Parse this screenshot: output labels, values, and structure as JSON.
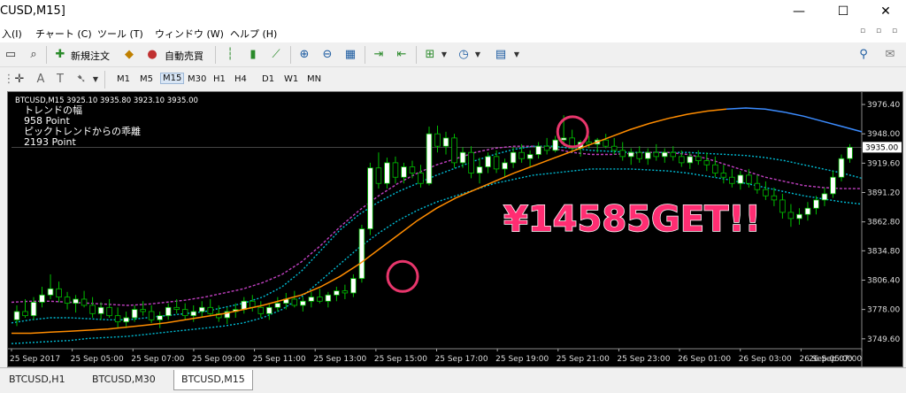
{
  "window": {
    "title": "CUSD,M15]",
    "minimize": "—",
    "maximize": "☐",
    "close": "✕"
  },
  "menu": [
    "入(I)",
    "チャート (C)",
    "ツール (T)",
    "ウィンドウ (W)",
    "ヘルプ (H)"
  ],
  "toolbar": {
    "new_order": "新規注文",
    "auto_trade": "自動売買"
  },
  "timeframes": [
    "M1",
    "M5",
    "M15",
    "M30",
    "H1",
    "H4",
    "D1",
    "W1",
    "MN"
  ],
  "active_timeframe": "M15",
  "chart_data": {
    "type": "candlestick",
    "symbol_header": "BTCUSD,M15  3925.10 3935.80 3923.10 3935.00",
    "indicator_lines": [
      "トレンドの幅",
      "958 Point",
      "ピックトレンドからの乖離",
      "2193 Point"
    ],
    "annotation": "¥14585GET!!",
    "current_price": "3935.00",
    "y_ticks": [
      "3976.40",
      "3948.00",
      "3919.60",
      "3891.20",
      "3862.80",
      "3834.80",
      "3806.40",
      "3778.00",
      "3749.60"
    ],
    "x_ticks": [
      "25 Sep 2017",
      "25 Sep 05:00",
      "25 Sep 07:00",
      "25 Sep 09:00",
      "25 Sep 11:00",
      "25 Sep 13:00",
      "25 Sep 15:00",
      "25 Sep 17:00",
      "25 Sep 19:00",
      "25 Sep 21:00",
      "25 Sep 23:00",
      "26 Sep 01:00",
      "26 Sep 03:00",
      "26 Sep 05:00",
      "26 Sep 07:00"
    ],
    "ylim": [
      3740,
      3985
    ],
    "candles": [
      [
        3768,
        3782,
        3762,
        3776
      ],
      [
        3776,
        3788,
        3770,
        3772
      ],
      [
        3772,
        3790,
        3768,
        3785
      ],
      [
        3785,
        3800,
        3780,
        3792
      ],
      [
        3792,
        3812,
        3788,
        3798
      ],
      [
        3798,
        3805,
        3785,
        3790
      ],
      [
        3790,
        3795,
        3778,
        3784
      ],
      [
        3784,
        3792,
        3775,
        3788
      ],
      [
        3788,
        3796,
        3780,
        3782
      ],
      [
        3782,
        3790,
        3770,
        3774
      ],
      [
        3774,
        3785,
        3768,
        3780
      ],
      [
        3780,
        3788,
        3770,
        3772
      ],
      [
        3772,
        3780,
        3760,
        3766
      ],
      [
        3766,
        3776,
        3760,
        3770
      ],
      [
        3770,
        3782,
        3766,
        3778
      ],
      [
        3778,
        3786,
        3772,
        3776
      ],
      [
        3776,
        3782,
        3765,
        3768
      ],
      [
        3768,
        3776,
        3760,
        3772
      ],
      [
        3772,
        3784,
        3768,
        3780
      ],
      [
        3780,
        3788,
        3774,
        3778
      ],
      [
        3778,
        3784,
        3768,
        3772
      ],
      [
        3772,
        3782,
        3766,
        3776
      ],
      [
        3776,
        3786,
        3770,
        3780
      ],
      [
        3780,
        3788,
        3772,
        3774
      ],
      [
        3774,
        3782,
        3766,
        3770
      ],
      [
        3770,
        3780,
        3764,
        3776
      ],
      [
        3776,
        3784,
        3770,
        3778
      ],
      [
        3778,
        3790,
        3774,
        3786
      ],
      [
        3786,
        3792,
        3776,
        3780
      ],
      [
        3780,
        3786,
        3770,
        3774
      ],
      [
        3774,
        3784,
        3768,
        3780
      ],
      [
        3780,
        3790,
        3776,
        3784
      ],
      [
        3784,
        3794,
        3778,
        3788
      ],
      [
        3788,
        3796,
        3780,
        3782
      ],
      [
        3782,
        3790,
        3776,
        3786
      ],
      [
        3786,
        3795,
        3780,
        3790
      ],
      [
        3790,
        3798,
        3784,
        3786
      ],
      [
        3786,
        3795,
        3780,
        3792
      ],
      [
        3792,
        3800,
        3786,
        3796
      ],
      [
        3796,
        3802,
        3788,
        3794
      ],
      [
        3794,
        3812,
        3790,
        3808
      ],
      [
        3808,
        3860,
        3804,
        3856
      ],
      [
        3856,
        3920,
        3850,
        3915
      ],
      [
        3915,
        3930,
        3895,
        3900
      ],
      [
        3900,
        3925,
        3895,
        3920
      ],
      [
        3920,
        3926,
        3900,
        3906
      ],
      [
        3906,
        3920,
        3900,
        3916
      ],
      [
        3916,
        3922,
        3905,
        3910
      ],
      [
        3910,
        3918,
        3896,
        3900
      ],
      [
        3900,
        3955,
        3898,
        3948
      ],
      [
        3948,
        3956,
        3930,
        3936
      ],
      [
        3936,
        3950,
        3928,
        3944
      ],
      [
        3944,
        3948,
        3915,
        3920
      ],
      [
        3920,
        3935,
        3915,
        3930
      ],
      [
        3930,
        3936,
        3905,
        3910
      ],
      [
        3910,
        3925,
        3900,
        3916
      ],
      [
        3916,
        3930,
        3910,
        3926
      ],
      [
        3926,
        3932,
        3910,
        3914
      ],
      [
        3914,
        3924,
        3906,
        3920
      ],
      [
        3920,
        3935,
        3915,
        3930
      ],
      [
        3930,
        3938,
        3920,
        3924
      ],
      [
        3924,
        3932,
        3916,
        3928
      ],
      [
        3928,
        3940,
        3924,
        3936
      ],
      [
        3936,
        3944,
        3928,
        3932
      ],
      [
        3932,
        3946,
        3930,
        3942
      ],
      [
        3942,
        3966,
        3936,
        3944
      ],
      [
        3944,
        3952,
        3930,
        3934
      ],
      [
        3934,
        3942,
        3926,
        3940
      ],
      [
        3940,
        3946,
        3934,
        3938
      ],
      [
        3938,
        3944,
        3930,
        3942
      ],
      [
        3942,
        3948,
        3934,
        3936
      ],
      [
        3936,
        3944,
        3928,
        3932
      ],
      [
        3932,
        3940,
        3922,
        3926
      ],
      [
        3926,
        3934,
        3918,
        3930
      ],
      [
        3930,
        3936,
        3920,
        3924
      ],
      [
        3924,
        3934,
        3918,
        3930
      ],
      [
        3930,
        3938,
        3922,
        3926
      ],
      [
        3926,
        3934,
        3920,
        3930
      ],
      [
        3930,
        3936,
        3922,
        3926
      ],
      [
        3926,
        3932,
        3916,
        3920
      ],
      [
        3920,
        3930,
        3914,
        3926
      ],
      [
        3926,
        3932,
        3918,
        3922
      ],
      [
        3922,
        3930,
        3912,
        3918
      ],
      [
        3918,
        3926,
        3906,
        3910
      ],
      [
        3910,
        3918,
        3900,
        3906
      ],
      [
        3906,
        3914,
        3896,
        3900
      ],
      [
        3900,
        3912,
        3894,
        3908
      ],
      [
        3908,
        3914,
        3896,
        3900
      ],
      [
        3900,
        3908,
        3890,
        3894
      ],
      [
        3894,
        3902,
        3884,
        3888
      ],
      [
        3888,
        3896,
        3878,
        3884
      ],
      [
        3884,
        3890,
        3866,
        3872
      ],
      [
        3872,
        3880,
        3858,
        3866
      ],
      [
        3866,
        3876,
        3860,
        3870
      ],
      [
        3870,
        3882,
        3864,
        3876
      ],
      [
        3876,
        3888,
        3870,
        3884
      ],
      [
        3884,
        3896,
        3878,
        3890
      ],
      [
        3890,
        3912,
        3886,
        3906
      ],
      [
        3906,
        3928,
        3902,
        3924
      ],
      [
        3924,
        3938,
        3920,
        3935
      ]
    ],
    "orange_ma": [
      3755,
      3755,
      3756,
      3757,
      3758,
      3759,
      3761,
      3763,
      3765,
      3768,
      3771,
      3774,
      3778,
      3782,
      3787,
      3792,
      3800,
      3810,
      3822,
      3836,
      3850,
      3864,
      3876,
      3886,
      3894,
      3902,
      3910,
      3917,
      3924,
      3931,
      3938,
      3945,
      3952,
      3958,
      3963,
      3967,
      3970,
      3972,
      3973,
      3972,
      3969,
      3965,
      3960,
      3955,
      3950
    ],
    "cyan_band_upper": [
      3765,
      3768,
      3770,
      3770,
      3769,
      3768,
      3768,
      3770,
      3772,
      3774,
      3776,
      3780,
      3784,
      3790,
      3800,
      3815,
      3835,
      3855,
      3870,
      3882,
      3892,
      3900,
      3908,
      3915,
      3922,
      3928,
      3933,
      3936,
      3936,
      3934,
      3932,
      3931,
      3930,
      3930,
      3930,
      3930,
      3929,
      3928,
      3927,
      3925,
      3922,
      3918,
      3914,
      3910,
      3905
    ],
    "cyan_band_lower": [
      3745,
      3746,
      3747,
      3748,
      3750,
      3751,
      3752,
      3754,
      3756,
      3758,
      3760,
      3762,
      3765,
      3770,
      3778,
      3790,
      3806,
      3822,
      3838,
      3852,
      3864,
      3874,
      3882,
      3888,
      3894,
      3900,
      3904,
      3908,
      3910,
      3912,
      3914,
      3914,
      3914,
      3913,
      3912,
      3910,
      3907,
      3904,
      3900,
      3896,
      3892,
      3888,
      3885,
      3882,
      3880
    ],
    "magenta_band": [
      3785,
      3786,
      3786,
      3785,
      3784,
      3783,
      3782,
      3783,
      3785,
      3787,
      3790,
      3794,
      3798,
      3804,
      3812,
      3824,
      3840,
      3858,
      3874,
      3888,
      3900,
      3910,
      3918,
      3924,
      3930,
      3934,
      3936,
      3936,
      3934,
      3930,
      3928,
      3928,
      3929,
      3930,
      3930,
      3928,
      3924,
      3918,
      3912,
      3906,
      3902,
      3898,
      3896,
      3895,
      3895
    ],
    "circles": [
      {
        "x": 46,
        "y": 3810
      },
      {
        "x": 66,
        "y": 3950
      }
    ]
  },
  "tabs": [
    "BTCUSD,H1",
    "BTCUSD,M30",
    "BTCUSD,M15"
  ],
  "active_tab": "BTCUSD,M15",
  "colors": {
    "background": "#000000",
    "bull_candle": "#ffffff",
    "bear_candle": "#000000",
    "candle_wick": "#00c000",
    "orange_ma": "#ff8c00",
    "blue_ma": "#3c8cff",
    "cyan_band": "#00bcd4",
    "magenta_band": "#c040c0",
    "annotation": "#ff2d72",
    "circle": "#e8366c"
  }
}
